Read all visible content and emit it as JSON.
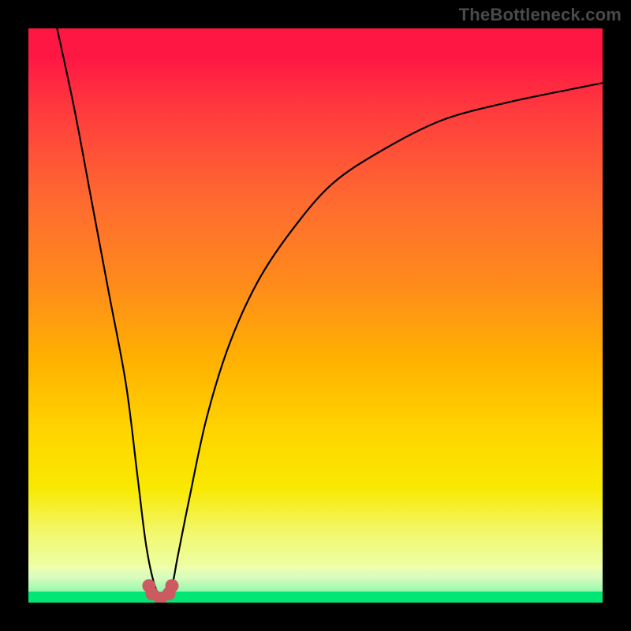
{
  "watermark": "TheBottleneck.com",
  "chart_data": {
    "type": "line",
    "title": "",
    "xlabel": "",
    "ylabel": "",
    "xlim": [
      0,
      100
    ],
    "ylim": [
      0,
      100
    ],
    "grid": false,
    "legend": false,
    "series": [
      {
        "name": "bottleneck-curve",
        "x": [
          5,
          8,
          11,
          14,
          17,
          19,
          20.5,
          22,
          23.5,
          25,
          26,
          28,
          31,
          35,
          40,
          46,
          53,
          62,
          72,
          83,
          95,
          100
        ],
        "values": [
          100,
          86,
          70,
          54,
          38,
          22,
          10,
          3,
          0.5,
          3,
          8,
          18,
          32,
          45,
          56,
          65,
          73,
          79,
          84,
          87,
          89.5,
          90.5
        ]
      }
    ],
    "annotations": [
      {
        "type": "marker-cluster",
        "shape": "rounded",
        "color": "#d66",
        "x_range": [
          21,
          25
        ],
        "y": 1
      }
    ],
    "background": "vertical-gradient red→yellow→green"
  }
}
